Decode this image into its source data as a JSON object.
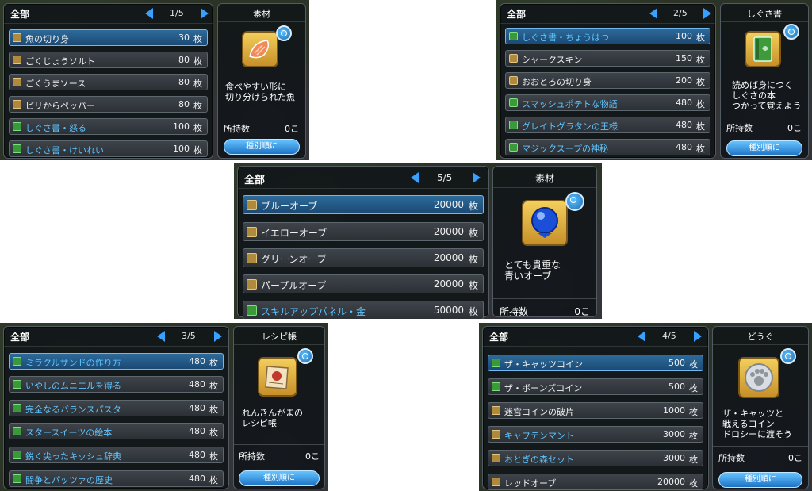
{
  "panels": [
    {
      "category": "全部",
      "page": "1/5",
      "items": [
        {
          "name": "魚の切り身",
          "price": "30",
          "unit": "枚",
          "icon": "material-icon",
          "blue": false,
          "selected": true
        },
        {
          "name": "ごくじょうソルト",
          "price": "80",
          "unit": "枚",
          "icon": "material-icon",
          "blue": false,
          "selected": false
        },
        {
          "name": "ごくうまソース",
          "price": "80",
          "unit": "枚",
          "icon": "material-icon",
          "blue": false,
          "selected": false
        },
        {
          "name": "ピリからペッパー",
          "price": "80",
          "unit": "枚",
          "icon": "material-icon",
          "blue": false,
          "selected": false
        },
        {
          "name": "しぐさ書・怒る",
          "price": "100",
          "unit": "枚",
          "icon": "book-icon",
          "blue": true,
          "selected": false
        },
        {
          "name": "しぐさ書・けいれい",
          "price": "100",
          "unit": "枚",
          "icon": "book-icon",
          "blue": true,
          "selected": false
        }
      ],
      "detail": {
        "type": "素材",
        "icon": "fish-fillet-icon",
        "description": "食べやすい形に\n切り分けられた魚",
        "owned_label": "所持数",
        "owned_value": "0こ",
        "sort_label": "種別順に"
      }
    },
    {
      "category": "全部",
      "page": "2/5",
      "items": [
        {
          "name": "しぐさ書・ちょうはつ",
          "price": "100",
          "unit": "枚",
          "icon": "book-icon",
          "blue": true,
          "selected": true
        },
        {
          "name": "シャークスキン",
          "price": "150",
          "unit": "枚",
          "icon": "material-icon",
          "blue": false,
          "selected": false
        },
        {
          "name": "おおとろの切り身",
          "price": "200",
          "unit": "枚",
          "icon": "material-icon",
          "blue": false,
          "selected": false
        },
        {
          "name": "スマッシュポテトな物語",
          "price": "480",
          "unit": "枚",
          "icon": "book-icon",
          "blue": true,
          "selected": false
        },
        {
          "name": "グレイトグラタンの王様",
          "price": "480",
          "unit": "枚",
          "icon": "book-icon",
          "blue": true,
          "selected": false
        },
        {
          "name": "マジックスープの神秘",
          "price": "480",
          "unit": "枚",
          "icon": "book-icon",
          "blue": true,
          "selected": false
        }
      ],
      "detail": {
        "type": "しぐさ書",
        "icon": "green-book-icon",
        "description": "読めば身につく\nしぐさの本\nつかって覚えよう",
        "owned_label": "所持数",
        "owned_value": "0こ",
        "sort_label": "種別順に"
      }
    },
    {
      "category": "全部",
      "page": "5/5",
      "items": [
        {
          "name": "ブルーオーブ",
          "price": "20000",
          "unit": "枚",
          "icon": "material-icon",
          "blue": false,
          "selected": true
        },
        {
          "name": "イエローオーブ",
          "price": "20000",
          "unit": "枚",
          "icon": "material-icon",
          "blue": false,
          "selected": false
        },
        {
          "name": "グリーンオーブ",
          "price": "20000",
          "unit": "枚",
          "icon": "material-icon",
          "blue": false,
          "selected": false
        },
        {
          "name": "パープルオーブ",
          "price": "20000",
          "unit": "枚",
          "icon": "material-icon",
          "blue": false,
          "selected": false
        },
        {
          "name": "スキルアップパネル・金",
          "price": "50000",
          "unit": "枚",
          "icon": "book-icon",
          "blue": true,
          "selected": false
        }
      ],
      "detail": {
        "type": "素材",
        "icon": "blue-orb-icon",
        "description": "とても貴重な\n青いオーブ",
        "owned_label": "所持数",
        "owned_value": "0こ",
        "sort_label": ""
      }
    },
    {
      "category": "全部",
      "page": "3/5",
      "items": [
        {
          "name": "ミラクルサンドの作り方",
          "price": "480",
          "unit": "枚",
          "icon": "book-icon",
          "blue": true,
          "selected": true
        },
        {
          "name": "いやしのムニエルを得る",
          "price": "480",
          "unit": "枚",
          "icon": "book-icon",
          "blue": true,
          "selected": false
        },
        {
          "name": "完全なるバランスパスタ",
          "price": "480",
          "unit": "枚",
          "icon": "book-icon",
          "blue": true,
          "selected": false
        },
        {
          "name": "スタースイーツの絵本",
          "price": "480",
          "unit": "枚",
          "icon": "book-icon",
          "blue": true,
          "selected": false
        },
        {
          "name": "鋭く尖ったキッシュ辞典",
          "price": "480",
          "unit": "枚",
          "icon": "book-icon",
          "blue": true,
          "selected": false
        },
        {
          "name": "闘争とパッツァの歴史",
          "price": "480",
          "unit": "枚",
          "icon": "book-icon",
          "blue": true,
          "selected": false
        }
      ],
      "detail": {
        "type": "レシピ帳",
        "icon": "recipe-scroll-icon",
        "description": "れんきんがまの\nレシピ帳",
        "owned_label": "所持数",
        "owned_value": "0こ",
        "sort_label": "種別順に"
      }
    },
    {
      "category": "全部",
      "page": "4/5",
      "items": [
        {
          "name": "ザ・キャッツコイン",
          "price": "500",
          "unit": "枚",
          "icon": "book-icon",
          "blue": false,
          "selected": true
        },
        {
          "name": "ザ・ボーンズコイン",
          "price": "500",
          "unit": "枚",
          "icon": "book-icon",
          "blue": false,
          "selected": false
        },
        {
          "name": "迷宮コインの破片",
          "price": "1000",
          "unit": "枚",
          "icon": "material-icon",
          "blue": false,
          "selected": false
        },
        {
          "name": "キャプテンマント",
          "price": "3000",
          "unit": "枚",
          "icon": "equipment-icon",
          "blue": true,
          "selected": false
        },
        {
          "name": "おとぎの森セット",
          "price": "3000",
          "unit": "枚",
          "icon": "equipment-icon",
          "blue": true,
          "selected": false
        },
        {
          "name": "レッドオーブ",
          "price": "20000",
          "unit": "枚",
          "icon": "material-icon",
          "blue": false,
          "selected": false
        }
      ],
      "detail": {
        "type": "どうぐ",
        "icon": "paw-coin-icon",
        "description": "ザ・キャッツと\n戦えるコイン\nドロシーに渡そう",
        "owned_label": "所持数",
        "owned_value": "0こ",
        "sort_label": "種別順に"
      }
    }
  ]
}
